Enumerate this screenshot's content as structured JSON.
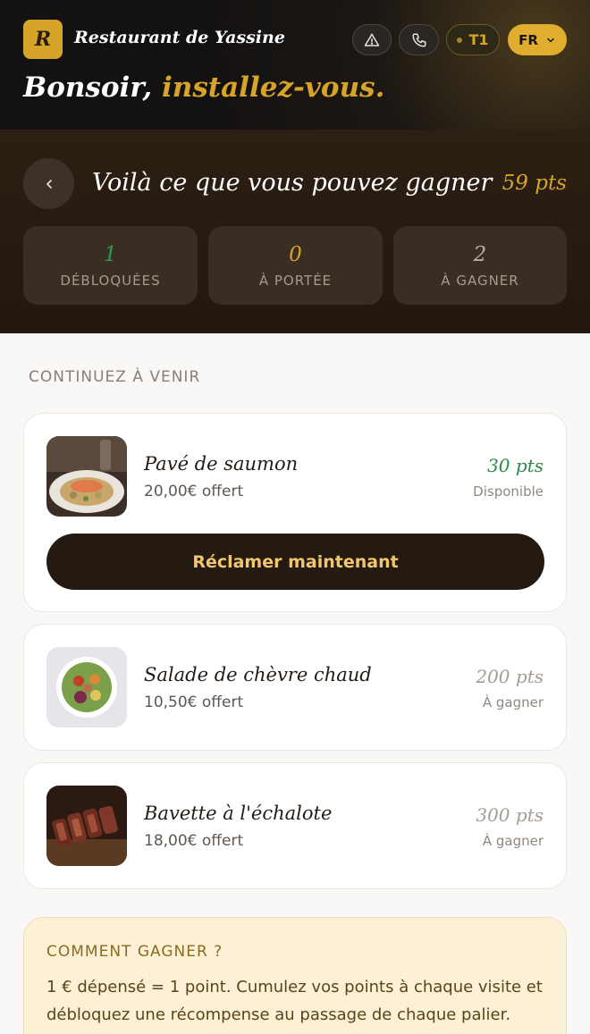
{
  "header": {
    "brand_letter": "R",
    "restaurant_name": "Restaurant de Yassine",
    "table_label": "T1",
    "language": "FR",
    "greeting_prefix": "Bonsoir,",
    "greeting_accent": "installez-vous."
  },
  "rewards": {
    "title": "Voilà ce que vous pouvez gagner",
    "points": "59 pts",
    "stats": [
      {
        "value": "1",
        "label": "DÉBLOQUÉES"
      },
      {
        "value": "0",
        "label": "À PORTÉE"
      },
      {
        "value": "2",
        "label": "À GAGNER"
      }
    ]
  },
  "section_label": "CONTINUEZ À VENIR",
  "items": [
    {
      "name": "Pavé de saumon",
      "offer": "20,00€ offert",
      "points": "30 pts",
      "status": "Disponible",
      "image": "salmon-dish-photo"
    },
    {
      "name": "Salade de chèvre chaud",
      "offer": "10,50€ offert",
      "points": "200 pts",
      "status": "À gagner",
      "image": "salad-bowl-photo"
    },
    {
      "name": "Bavette à l'échalote",
      "offer": "18,00€ offert",
      "points": "300 pts",
      "status": "À gagner",
      "image": "steak-photo"
    }
  ],
  "claim_button_label": "Réclamer maintenant",
  "how_to": {
    "title": "COMMENT GAGNER ?",
    "text": "1 € dépensé = 1 point. Cumulez vos points à chaque visite et débloquez une récompense au passage de chaque palier."
  },
  "colors": {
    "accent_gold": "#d6a429",
    "available_green": "#2b8a4a",
    "dark_brown": "#251a12"
  },
  "icons": [
    "alert-triangle-icon",
    "phone-icon",
    "chevron-down-icon",
    "chevron-left-icon"
  ]
}
